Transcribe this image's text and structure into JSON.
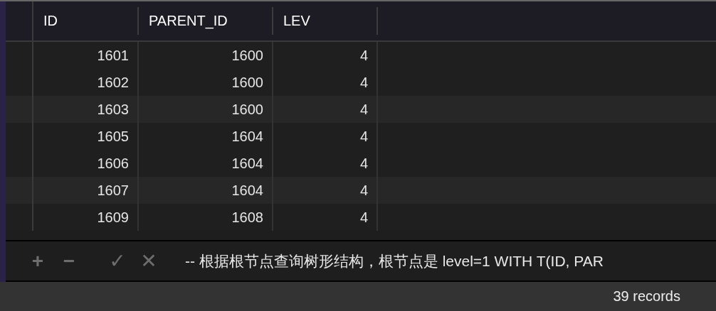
{
  "table": {
    "columns": [
      "ID",
      "PARENT_ID",
      "LEV"
    ],
    "rows": [
      {
        "cells": [
          "1601",
          "1600",
          "4"
        ]
      },
      {
        "cells": [
          "1602",
          "1600",
          "4"
        ]
      },
      {
        "cells": [
          "1603",
          "1600",
          "4"
        ]
      },
      {
        "cells": [
          "1605",
          "1604",
          "4"
        ]
      },
      {
        "cells": [
          "1606",
          "1604",
          "4"
        ]
      },
      {
        "cells": [
          "1607",
          "1604",
          "4"
        ]
      },
      {
        "cells": [
          "1609",
          "1608",
          "4"
        ]
      }
    ]
  },
  "toolbar": {
    "buttons": [
      {
        "kind": "add",
        "label": "+"
      },
      {
        "kind": "remove",
        "label": "−"
      },
      {
        "kind": "apply",
        "label": "✓"
      },
      {
        "kind": "cancel",
        "label": "✕"
      }
    ],
    "query": "-- 根据根节点查询树形结构，根节点是 level=1 WITH T(ID, PAR"
  },
  "status_bar": {
    "count": "39 records"
  }
}
